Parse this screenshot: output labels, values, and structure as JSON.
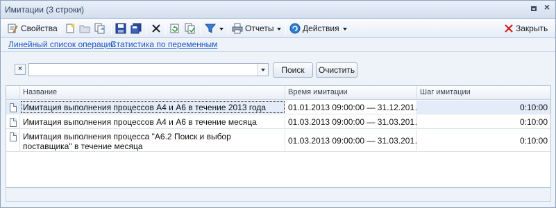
{
  "window": {
    "title": "Имитации (3 строки)"
  },
  "toolbar": {
    "properties_label": "Свойства",
    "reports_label": "Отчеты",
    "actions_label": "Действия",
    "close_label": "Закрыть"
  },
  "links": {
    "ops_list": "Линейный список операций",
    "var_stats": "Статистика по переменным"
  },
  "filter": {
    "search_value": "",
    "search_button": "Поиск",
    "clear_button": "Очистить"
  },
  "grid": {
    "columns": [
      "Название",
      "Время имитации",
      "Шаг имитации"
    ],
    "rows": [
      {
        "name": "Имитация выполнения процессов А4 и А6 в течение 2013 года",
        "time": "01.01.2013 09:00:00 — 31.12.201…",
        "step": "0:10:00"
      },
      {
        "name": "Имитация выполнения процессов А4 и А6 в течение месяца",
        "time": "01.03.2013 09:00:00 — 31.03.201…",
        "step": "0:10:00"
      },
      {
        "name": "Имитация выполнения процесса \"А6.2 Поиск и выбор поставщика\" в течение месяца",
        "time": "01.03.2013 09:00:00 — 31.03.201…",
        "step": "0:10:00"
      }
    ]
  },
  "colors": {
    "link": "#1a55c9",
    "selection": "#e3ecf8",
    "close_red": "#d0201a"
  }
}
